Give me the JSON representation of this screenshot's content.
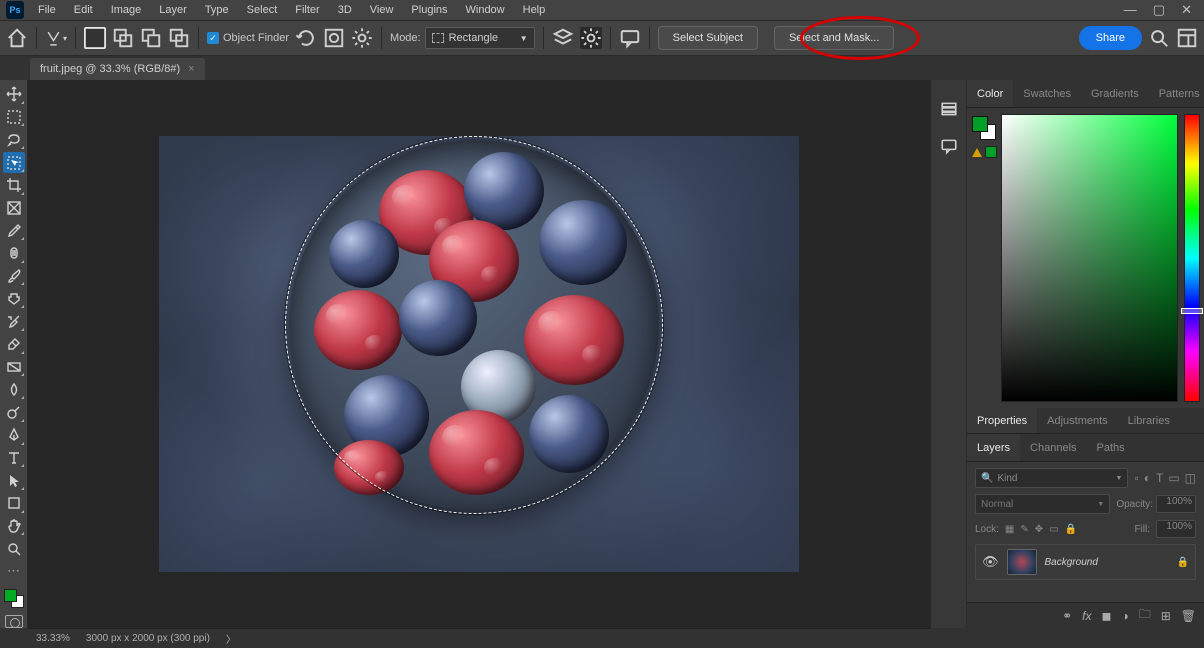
{
  "menubar": {
    "items": [
      "File",
      "Edit",
      "Image",
      "Layer",
      "Type",
      "Select",
      "Filter",
      "3D",
      "View",
      "Plugins",
      "Window",
      "Help"
    ]
  },
  "optionsbar": {
    "object_finder": "Object Finder",
    "mode_label": "Mode:",
    "mode_value": "Rectangle",
    "select_subject": "Select Subject",
    "select_mask": "Select and Mask...",
    "share": "Share"
  },
  "doctab": {
    "label": "fruit.jpeg @ 33.3% (RGB/8#)"
  },
  "panels": {
    "color_tabs": [
      "Color",
      "Swatches",
      "Gradients",
      "Patterns"
    ],
    "mid_tabs": [
      "Properties",
      "Adjustments",
      "Libraries"
    ],
    "layer_tabs": [
      "Layers",
      "Channels",
      "Paths"
    ]
  },
  "layers": {
    "kind": "Kind",
    "blend_mode": "Normal",
    "opacity_label": "Opacity:",
    "opacity_value": "100%",
    "lock_label": "Lock:",
    "fill_label": "Fill:",
    "fill_value": "100%",
    "items": [
      {
        "name": "Background",
        "locked": true
      }
    ]
  },
  "statusbar": {
    "zoom": "33.33%",
    "dims": "3000 px x 2000 px (300 ppi)"
  },
  "colors": {
    "foreground": "#00a028",
    "background": "#ffffff"
  }
}
